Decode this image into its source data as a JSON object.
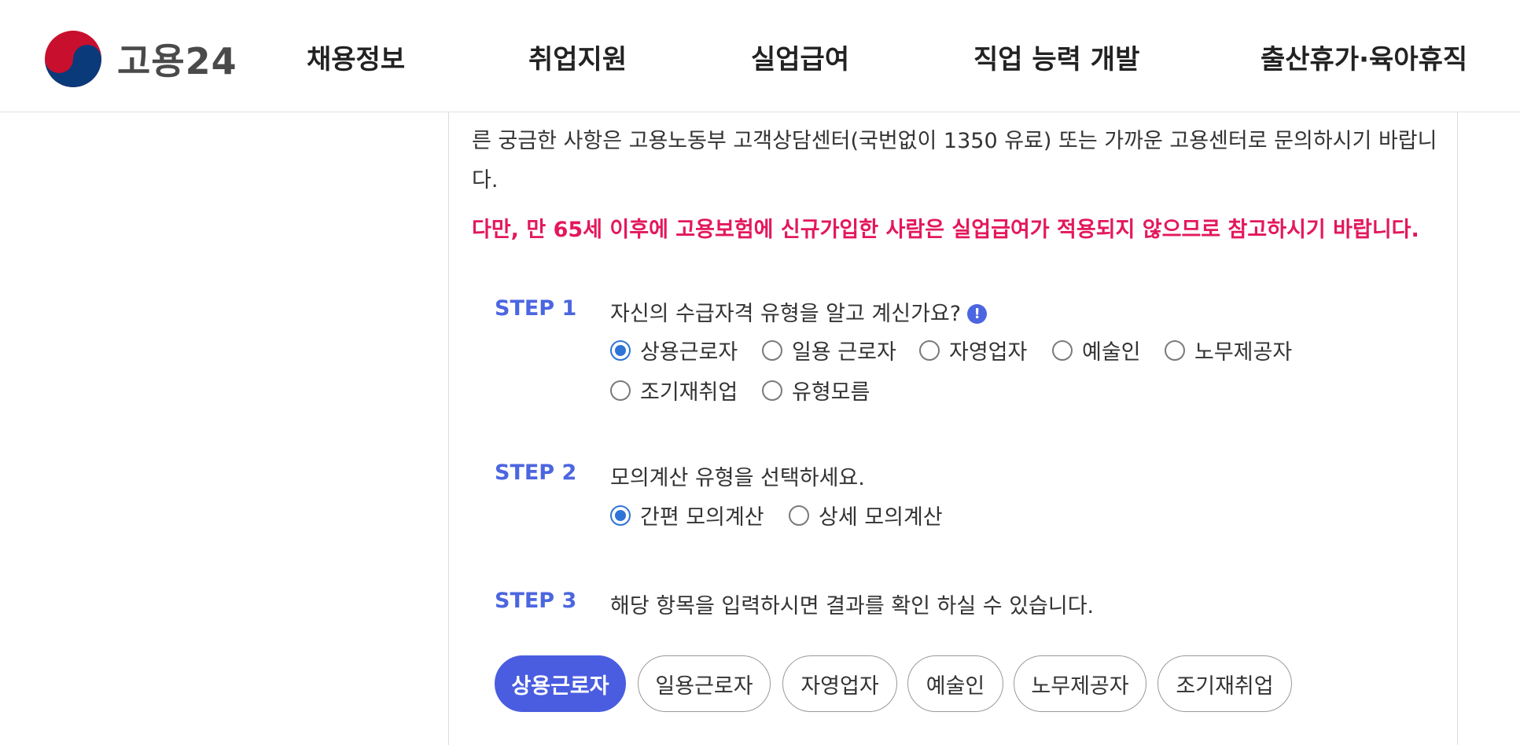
{
  "header": {
    "logo_text": "고용24",
    "nav": [
      "채용정보",
      "취업지원",
      "실업급여",
      "직업 능력 개발",
      "출산휴가·육아휴직"
    ]
  },
  "content": {
    "notice": "른 궁금한 사항은 고용노동부 고객상담센터(국번없이 1350 유료) 또는 가까운 고용센터로 문의하시기 바랍니다.",
    "warning": "다만, 만 65세 이후에 고용보험에 신규가입한 사람은 실업급여가 적용되지 않으므로 참고하시기 바랍니다.",
    "step1": {
      "label": "STEP 1",
      "title": "자신의 수급자격 유형을 알고 계신가요?",
      "info_icon": "!",
      "options": [
        "상용근로자",
        "일용 근로자",
        "자영업자",
        "예술인",
        "노무제공자",
        "조기재취업",
        "유형모름"
      ],
      "selected": "상용근로자"
    },
    "step2": {
      "label": "STEP 2",
      "title": "모의계산 유형을 선택하세요.",
      "options": [
        "간편 모의계산",
        "상세 모의계산"
      ],
      "selected": "간편 모의계산"
    },
    "step3": {
      "label": "STEP 3",
      "title": "해당 항목을 입력하시면 결과를 확인 하실 수 있습니다."
    },
    "tabs": [
      "상용근로자",
      "일용근로자",
      "자영업자",
      "예술인",
      "노무제공자",
      "조기재취업"
    ],
    "active_tab": "상용근로자"
  },
  "colors": {
    "accent": "#4a5de0",
    "step_label": "#4b66e0",
    "warning": "#e3185b",
    "radio_checked": "#2f74d6"
  }
}
